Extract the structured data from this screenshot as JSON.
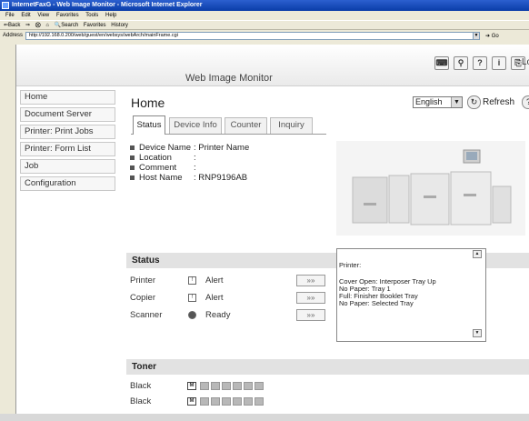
{
  "window": {
    "title": "InternetFaxG - Web Image Monitor - Microsoft Internet Explorer",
    "menu": [
      "File",
      "Edit",
      "View",
      "Favorites",
      "Tools",
      "Help"
    ],
    "toolbar": [
      "⇐Back",
      "⇒",
      "⨂",
      "⌂",
      "🔍Search",
      "Favorites",
      "History"
    ],
    "address_label": "Address",
    "address_value": "http://192.168.0.200/web/guest/en/websys/webArch/mainFrame.cgi",
    "go_label": "Go"
  },
  "header": {
    "product": "Web Image Monitor",
    "logout": "Logout"
  },
  "sidebar": {
    "items": [
      {
        "label": "Home"
      },
      {
        "label": "Document Server"
      },
      {
        "label": "Printer: Print Jobs"
      },
      {
        "label": "Printer: Form List"
      },
      {
        "label": "Job"
      },
      {
        "label": "Configuration"
      }
    ]
  },
  "main": {
    "title": "Home",
    "language": "English",
    "refresh": "Refresh",
    "tabs": [
      {
        "label": "Status"
      },
      {
        "label": "Device Info"
      },
      {
        "label": "Counter"
      },
      {
        "label": "Inquiry"
      }
    ],
    "info": [
      {
        "key": "Device Name",
        "value": ": Printer Name"
      },
      {
        "key": "Location",
        "value": ":"
      },
      {
        "key": "Comment",
        "value": ":"
      },
      {
        "key": "Host Name",
        "value": ": RNP9196AB"
      }
    ]
  },
  "status": {
    "title": "Status",
    "devices": [
      {
        "name": "Printer",
        "state": "Alert",
        "icon": "printer-alert-icon"
      },
      {
        "name": "Copier",
        "state": "Alert",
        "icon": "copier-alert-icon"
      },
      {
        "name": "Scanner",
        "state": "Ready",
        "icon": "scanner-ready-icon"
      }
    ],
    "message_header": "Printer:",
    "messages": [
      "Cover Open: Interposer Tray Up",
      "No Paper: Tray 1",
      "Full: Finisher Booklet Tray",
      "No Paper: Selected Tray"
    ]
  },
  "toner": {
    "title": "Toner",
    "rows": [
      {
        "label": "Black",
        "icon_text": "M",
        "level": 0.0
      },
      {
        "label": "Black",
        "icon_text": "M",
        "level": 0.0
      }
    ]
  },
  "colors": {
    "titlebar": "#0a3da8",
    "section_bar": "#e2e2e2",
    "sidebar_border": "#c8c8c8"
  }
}
